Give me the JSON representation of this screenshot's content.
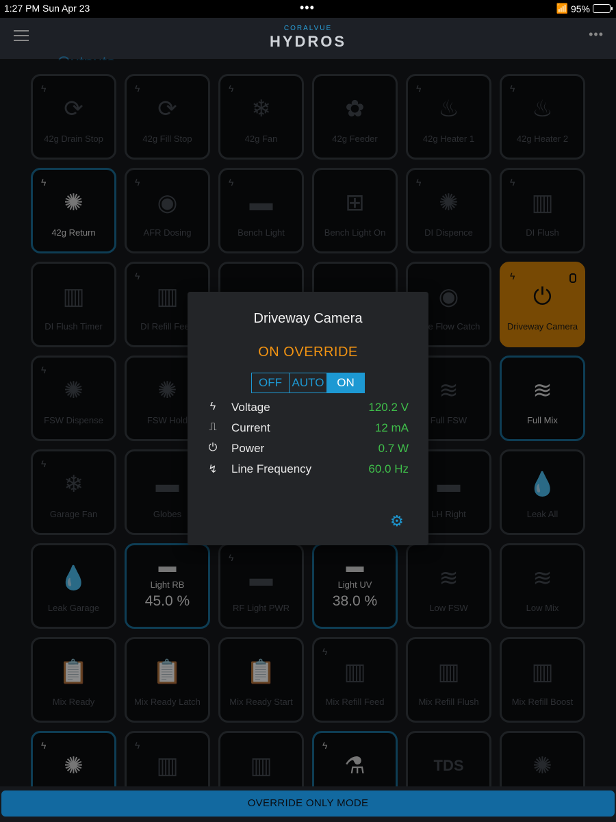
{
  "status_bar": {
    "time": "1:27 PM  Sun Apr 23",
    "dots": "•••",
    "battery": "95%"
  },
  "header": {
    "brand_small": "CORALVUE",
    "brand_big": "HYDROS",
    "more": "•••"
  },
  "tiles": [
    {
      "label": "42g Drain Stop",
      "icon": "drain-stop-icon",
      "glyph": "⟳",
      "bolt": true
    },
    {
      "label": "42g Fill Stop",
      "icon": "fill-stop-icon",
      "glyph": "⟳",
      "bolt": true
    },
    {
      "label": "42g Fan",
      "icon": "fan-icon",
      "glyph": "❄",
      "bolt": true
    },
    {
      "label": "42g Feeder",
      "icon": "feeder-icon",
      "glyph": "✿",
      "bolt": false
    },
    {
      "label": "42g Heater 1",
      "icon": "heater-icon",
      "glyph": "♨",
      "bolt": true
    },
    {
      "label": "42g Heater 2",
      "icon": "heater-icon",
      "glyph": "♨",
      "bolt": true
    },
    {
      "label": "42g Return",
      "icon": "pump-icon",
      "glyph": "✺",
      "bolt": true,
      "state": "active"
    },
    {
      "label": "AFR Dosing",
      "icon": "doser-icon",
      "glyph": "◉",
      "bolt": true
    },
    {
      "label": "Bench Light",
      "icon": "light-icon",
      "glyph": "▬",
      "bolt": true
    },
    {
      "label": "Bench Light On",
      "icon": "add-icon",
      "glyph": "⊞",
      "bolt": false
    },
    {
      "label": "DI Dispence",
      "icon": "pump-icon",
      "glyph": "✺",
      "bolt": true
    },
    {
      "label": "DI Flush",
      "icon": "filter-icon",
      "glyph": "▥",
      "bolt": true
    },
    {
      "label": "DI Flush Timer",
      "icon": "filter-icon",
      "glyph": "▥",
      "bolt": false
    },
    {
      "label": "DI Refill Feed",
      "icon": "filter-icon",
      "glyph": "▥",
      "bolt": true
    },
    {
      "label": "",
      "icon": "hidden-icon",
      "glyph": "",
      "bolt": false
    },
    {
      "label": "",
      "icon": "hidden-icon",
      "glyph": "",
      "bolt": false
    },
    {
      "label": "Dye Flow Catch",
      "icon": "doser-icon",
      "glyph": "◉",
      "bolt": false
    },
    {
      "label": "Driveway Camera",
      "icon": "power-plug-icon",
      "glyph": "⏻",
      "bolt": true,
      "state": "orange"
    },
    {
      "label": "FSW Dispense",
      "icon": "pump-icon",
      "glyph": "✺",
      "bolt": true
    },
    {
      "label": "FSW Hold",
      "icon": "pump-icon",
      "glyph": "✺",
      "bolt": false
    },
    {
      "label": "",
      "icon": "hidden-icon",
      "glyph": "",
      "bolt": false
    },
    {
      "label": "",
      "icon": "hidden-icon",
      "glyph": "",
      "bolt": false
    },
    {
      "label": "Full FSW",
      "icon": "water-level-icon",
      "glyph": "≋",
      "bolt": false
    },
    {
      "label": "Full Mix",
      "icon": "water-level-icon",
      "glyph": "≋",
      "bolt": false,
      "state": "active"
    },
    {
      "label": "Garage Fan",
      "icon": "fan-icon",
      "glyph": "❄",
      "bolt": true
    },
    {
      "label": "Globes",
      "icon": "light-icon",
      "glyph": "▬",
      "bolt": false
    },
    {
      "label": "",
      "icon": "hidden-icon",
      "glyph": "",
      "bolt": false
    },
    {
      "label": "",
      "icon": "hidden-icon",
      "glyph": "",
      "bolt": false
    },
    {
      "label": "LH Right",
      "icon": "light-icon",
      "glyph": "▬",
      "bolt": false
    },
    {
      "label": "Leak All",
      "icon": "leak-icon",
      "glyph": "💧",
      "bolt": false
    },
    {
      "label": "Leak Garage",
      "icon": "leak-icon",
      "glyph": "💧",
      "bolt": false
    },
    {
      "label": "Light RB",
      "icon": "light-icon",
      "glyph": "▬",
      "bolt": false,
      "state": "active",
      "value": "45.0 %"
    },
    {
      "label": "RF Light PWR",
      "icon": "light-icon",
      "glyph": "▬",
      "bolt": true
    },
    {
      "label": "Light UV",
      "icon": "light-icon",
      "glyph": "▬",
      "bolt": false,
      "state": "active",
      "value": "38.0 %"
    },
    {
      "label": "Low FSW",
      "icon": "water-level-icon",
      "glyph": "≋",
      "bolt": false
    },
    {
      "label": "Low Mix",
      "icon": "water-level-icon",
      "glyph": "≋",
      "bolt": false
    },
    {
      "label": "Mix Ready",
      "icon": "clipboard-icon",
      "glyph": "📋",
      "bolt": false
    },
    {
      "label": "Mix Ready Latch",
      "icon": "clipboard-icon",
      "glyph": "📋",
      "bolt": false
    },
    {
      "label": "Mix Ready Start",
      "icon": "clipboard-icon",
      "glyph": "📋",
      "bolt": false
    },
    {
      "label": "Mix Refill Feed",
      "icon": "filter-icon",
      "glyph": "▥",
      "bolt": true
    },
    {
      "label": "Mix Refill Flush",
      "icon": "filter-icon",
      "glyph": "▥",
      "bolt": false
    },
    {
      "label": "Mix Refill Boost",
      "icon": "filter-icon",
      "glyph": "▥",
      "bolt": false
    },
    {
      "label": "",
      "icon": "pump-icon",
      "glyph": "✺",
      "bolt": true,
      "state": "active"
    },
    {
      "label": "",
      "icon": "filter-icon",
      "glyph": "▥",
      "bolt": true
    },
    {
      "label": "",
      "icon": "filter-icon",
      "glyph": "▥",
      "bolt": false
    },
    {
      "label": "",
      "icon": "dosing-stand-icon",
      "glyph": "⚗",
      "bolt": true,
      "state": "active"
    },
    {
      "label": "",
      "icon": "tds-icon",
      "glyph": "TDS",
      "bolt": false
    },
    {
      "label": "",
      "icon": "pump-icon",
      "glyph": "✺",
      "bolt": false
    }
  ],
  "popup": {
    "title": "Driveway Camera",
    "state": "ON OVERRIDE",
    "modes": [
      "OFF",
      "AUTO",
      "ON"
    ],
    "selected_mode": "ON",
    "readings": [
      {
        "icon": "bolt-icon",
        "glyph": "ϟ",
        "label": "Voltage",
        "value": "120.2 V"
      },
      {
        "icon": "waveform-icon",
        "glyph": "⎍",
        "label": "Current",
        "value": "12 mA"
      },
      {
        "icon": "plug-icon",
        "glyph": "⏻",
        "label": "Power",
        "value": "0.7 W"
      },
      {
        "icon": "frequency-icon",
        "glyph": "↯",
        "label": "Line Frequency",
        "value": "60.0 Hz"
      }
    ],
    "accent_color": "#f39412",
    "value_color": "#3fbf4a"
  },
  "bottom": {
    "override_label": "OVERRIDE ONLY MODE"
  }
}
